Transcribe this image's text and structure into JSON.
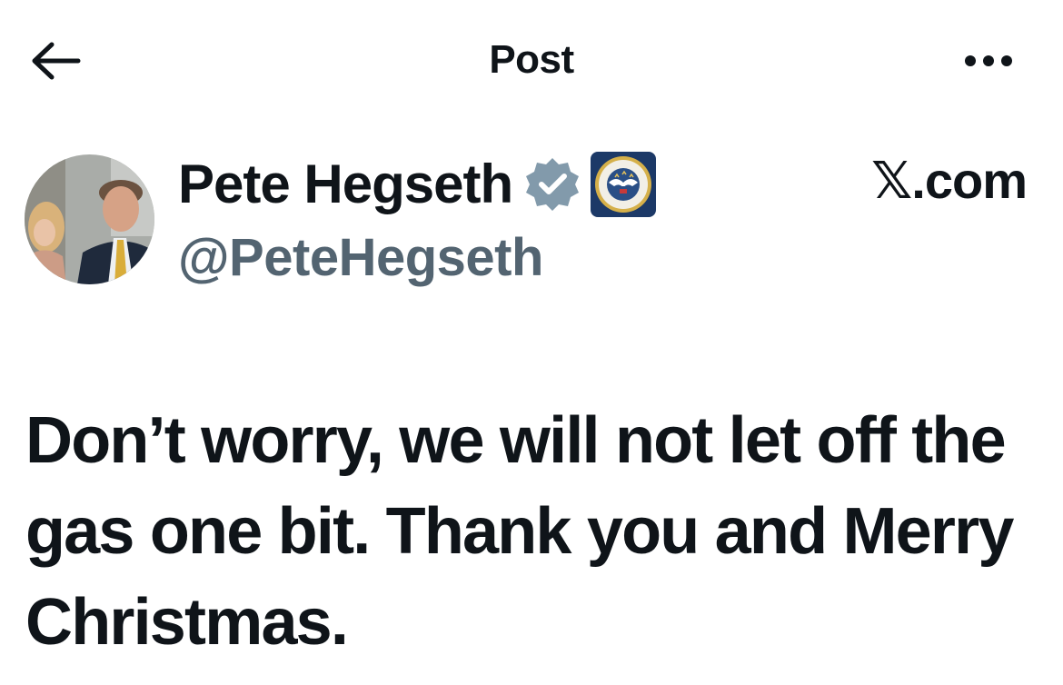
{
  "header": {
    "title": "Post",
    "back_icon": "arrow-left-icon",
    "more_icon": "more-horizontal-icon"
  },
  "author": {
    "display_name": "Pete Hegseth",
    "handle": "@PeteHegseth",
    "verified_badge": "verified-badge-icon",
    "verified_color": "#829aab",
    "affiliation_badge": "department-of-war-seal",
    "affiliation_badge_text": "DEPARTMENT OF WAR · UNITED STATES OF AMERICA"
  },
  "watermark": "𝕏.com",
  "post": {
    "text": "Don’t worry, we will not let off the gas one bit. Thank you and Merry Christmas."
  },
  "colors": {
    "text_primary": "#0f1419",
    "text_secondary": "#536471",
    "background": "#ffffff"
  }
}
